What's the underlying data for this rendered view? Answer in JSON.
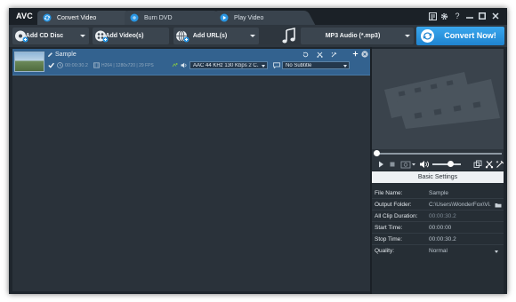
{
  "app": {
    "logo": "AVC"
  },
  "tabs": [
    {
      "label": "Convert Video",
      "icon": "convert-icon"
    },
    {
      "label": "Burn DVD",
      "icon": "disc-icon"
    },
    {
      "label": "Play Video",
      "icon": "play-icon"
    }
  ],
  "window_controls": [
    "register-icon",
    "settings-icon",
    "help-icon",
    "minimize-icon",
    "maximize-icon",
    "close-icon"
  ],
  "window_glyphs": {
    "help": "?"
  },
  "toolbar": {
    "add_cd": "Add CD Disc",
    "add_video": "Add Video(s)",
    "add_url": "Add URL(s)",
    "format": "MP3 Audio (*.mp3)",
    "convert": "Convert Now!"
  },
  "file": {
    "name": "Sample",
    "duration": "00:00:30.2",
    "video_info": "H264 | 1280x720 | 29 FPS",
    "audio_track": "AAC 44 KHz 130 Kbps 2 C...",
    "subtitle": "No Subtitle"
  },
  "settings": {
    "title": "Basic Settings",
    "rows": [
      {
        "key": "File Name:",
        "value": "Sample"
      },
      {
        "key": "Output Folder:",
        "value": "C:\\Users\\WonderFox\\Vi..."
      },
      {
        "key": "All Clip Duration:",
        "value": "00:00:30.2"
      },
      {
        "key": "Start Time:",
        "value": "00:00:00"
      },
      {
        "key": "Stop Time:",
        "value": "00:00:30.2"
      },
      {
        "key": "Quality:",
        "value": "Normal"
      }
    ]
  },
  "colors": {
    "accent": "#2a96e3",
    "selected_row": "#33628f",
    "background": "#1f262d"
  }
}
